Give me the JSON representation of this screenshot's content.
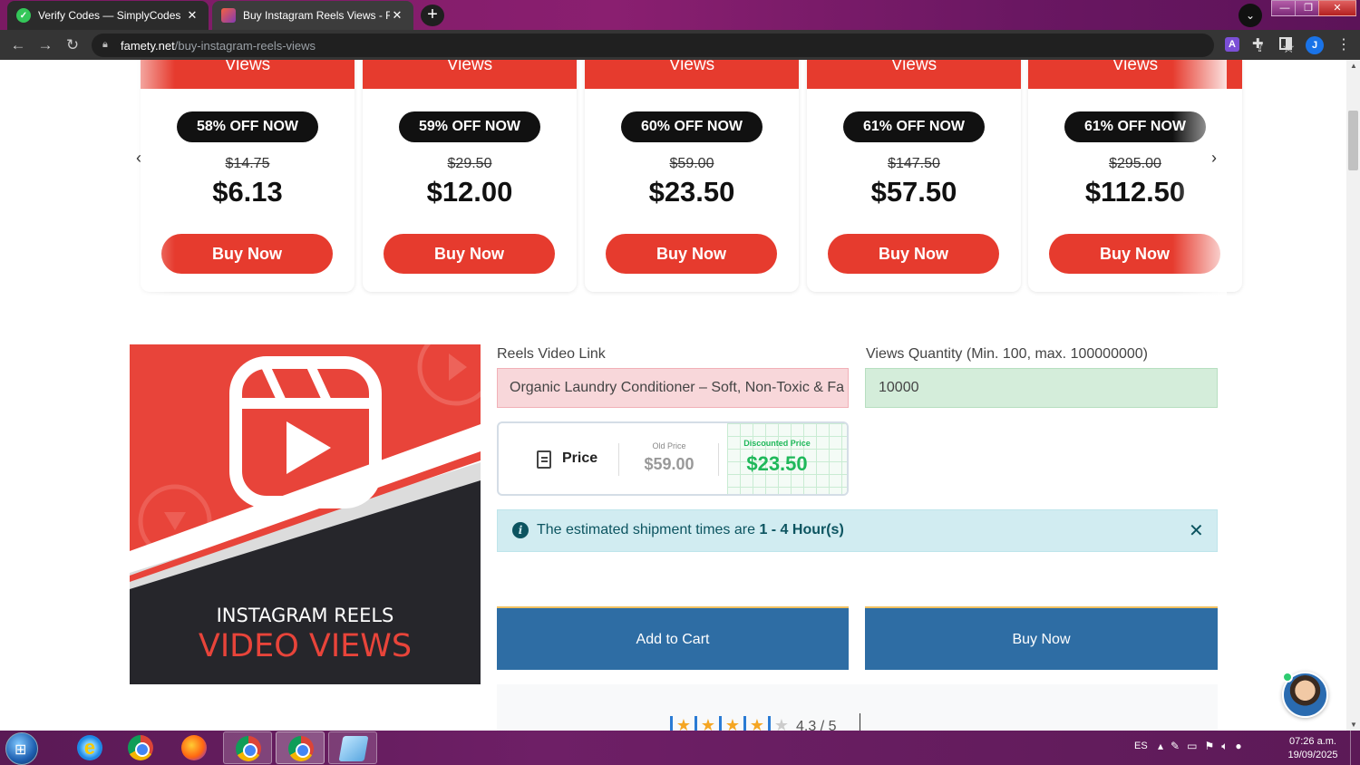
{
  "browser": {
    "tabs": [
      {
        "title": "Verify Codes — SimplyCodes",
        "close": "✕"
      },
      {
        "title": "Buy Instagram Reels Views - Real",
        "close": "✕"
      }
    ],
    "new_tab": "+",
    "url_host": "famety.net",
    "url_path": "/buy-instagram-reels-views",
    "profile_initial": "J",
    "extension_letter": "A",
    "window_controls": {
      "minimize": "—",
      "maximize": "❐",
      "close": "✕"
    }
  },
  "packages": [
    {
      "header": "Views",
      "discount": "58% OFF NOW",
      "old_price": "$14.75",
      "price": "$6.13",
      "buy_label": "Buy Now"
    },
    {
      "header": "Views",
      "discount": "59% OFF NOW",
      "old_price": "$29.50",
      "price": "$12.00",
      "buy_label": "Buy Now"
    },
    {
      "header": "Views",
      "discount": "60% OFF NOW",
      "old_price": "$59.00",
      "price": "$23.50",
      "buy_label": "Buy Now"
    },
    {
      "header": "Views",
      "discount": "61% OFF NOW",
      "old_price": "$147.50",
      "price": "$57.50",
      "buy_label": "Buy Now"
    },
    {
      "header": "Views",
      "discount": "61% OFF NOW",
      "old_price": "$295.00",
      "price": "$112.50",
      "buy_label": "Buy Now"
    }
  ],
  "carousel": {
    "prev": "‹",
    "next": "›"
  },
  "product_image": {
    "line1": "INSTAGRAM REELS",
    "line2": "VIDEO VIEWS"
  },
  "form": {
    "link_label": "Reels Video Link",
    "link_value": "Organic Laundry Conditioner – Soft, Non-Toxic & Fa",
    "quantity_label": "Views Quantity (Min. 100, max. 100000000)",
    "quantity_value": "10000"
  },
  "price_box": {
    "label": "Price",
    "old_price_label": "Old Price",
    "old_price": "$59.00",
    "discounted_label": "Discounted Price",
    "discounted_price": "$23.50"
  },
  "shipment": {
    "text_before": "The estimated shipment times are ",
    "time": "1 - 4 Hour(s)",
    "close": "✕"
  },
  "actions": {
    "add_to_cart": "Add to Cart",
    "buy_now": "Buy Now"
  },
  "rating": {
    "text": "4.3 / 5",
    "value": 4.3,
    "max": 5
  },
  "taskbar": {
    "language": "ES",
    "time": "07:26 a.m.",
    "date": "19/09/2025"
  },
  "colors": {
    "brand_red": "#e63b2e",
    "action_blue": "#2e6da4",
    "discount_green": "#1fb85a",
    "alert_bg": "#d1ecf1"
  }
}
